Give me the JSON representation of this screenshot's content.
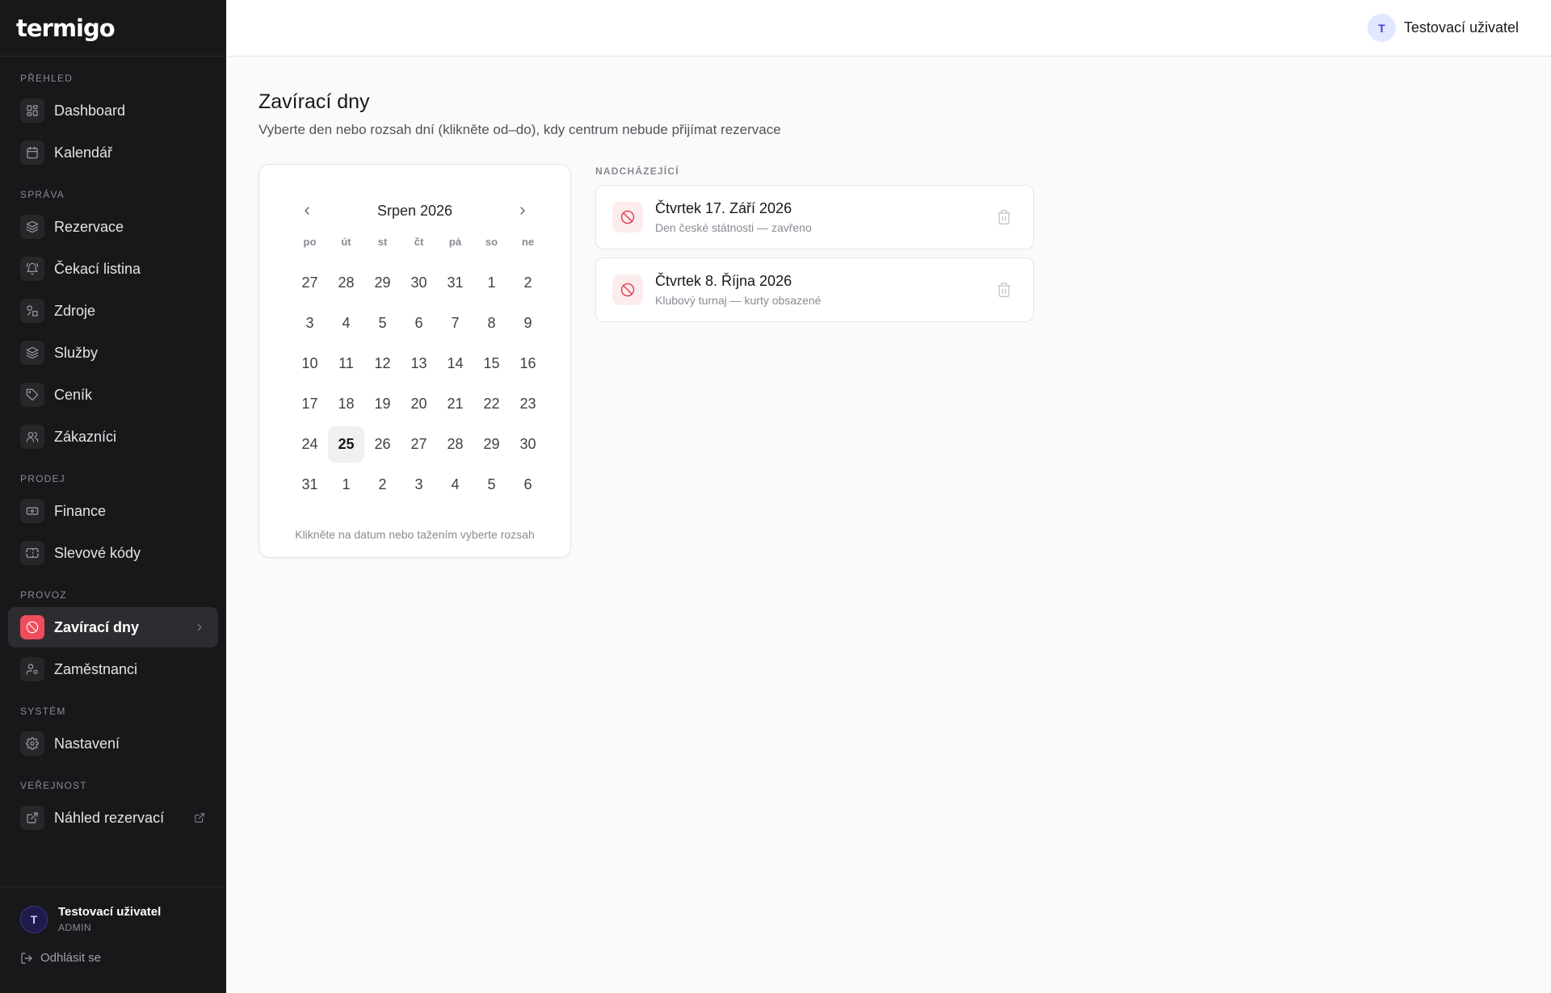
{
  "app": {
    "brand": "termigo"
  },
  "sidebar": {
    "sections": [
      {
        "label": "PŘEHLED",
        "items": [
          {
            "label": "Dashboard",
            "icon": "dashboard-icon"
          },
          {
            "label": "Kalendář",
            "icon": "calendar-icon"
          }
        ]
      },
      {
        "label": "SPRÁVA",
        "items": [
          {
            "label": "Rezervace",
            "icon": "layers-icon"
          },
          {
            "label": "Čekací listina",
            "icon": "bell-icon"
          },
          {
            "label": "Zdroje",
            "icon": "resources-icon"
          },
          {
            "label": "Služby",
            "icon": "layers-icon"
          },
          {
            "label": "Ceník",
            "icon": "tag-icon"
          },
          {
            "label": "Zákazníci",
            "icon": "users-icon"
          }
        ]
      },
      {
        "label": "PRODEJ",
        "items": [
          {
            "label": "Finance",
            "icon": "banknote-icon"
          },
          {
            "label": "Slevové kódy",
            "icon": "ticket-icon"
          }
        ]
      },
      {
        "label": "PROVOZ",
        "items": [
          {
            "label": "Zavírací dny",
            "icon": "ban-icon",
            "active": true
          },
          {
            "label": "Zaměstnanci",
            "icon": "user-cog-icon"
          }
        ]
      },
      {
        "label": "SYSTÉM",
        "items": [
          {
            "label": "Nastavení",
            "icon": "gear-icon"
          }
        ]
      },
      {
        "label": "VEŘEJNOST",
        "items": [
          {
            "label": "Náhled rezervací",
            "icon": "external-link-icon",
            "external": true
          }
        ]
      }
    ],
    "user": {
      "initial": "T",
      "name": "Testovací uživatel",
      "role": "ADMIN"
    },
    "logout_label": "Odhlásit se"
  },
  "topbar": {
    "user_initial": "T",
    "user_name": "Testovací uživatel"
  },
  "page": {
    "title": "Zavírací dny",
    "subtitle": "Vyberte den nebo rozsah dní (klikněte od–do), kdy centrum nebude přijímat rezervace"
  },
  "calendar": {
    "month_label": "Srpen 2026",
    "weekdays": [
      "po",
      "út",
      "st",
      "čt",
      "pá",
      "so",
      "ne"
    ],
    "weeks": [
      [
        "27",
        "28",
        "29",
        "30",
        "31",
        "1",
        "2"
      ],
      [
        "3",
        "4",
        "5",
        "6",
        "7",
        "8",
        "9"
      ],
      [
        "10",
        "11",
        "12",
        "13",
        "14",
        "15",
        "16"
      ],
      [
        "17",
        "18",
        "19",
        "20",
        "21",
        "22",
        "23"
      ],
      [
        "24",
        "25",
        "26",
        "27",
        "28",
        "29",
        "30"
      ],
      [
        "31",
        "1",
        "2",
        "3",
        "4",
        "5",
        "6"
      ]
    ],
    "today": "25",
    "hint": "Klikněte na datum nebo tažením vyberte rozsah"
  },
  "upcoming": {
    "label": "NADCHÁZEJÍCÍ",
    "items": [
      {
        "title": "Čtvrtek 17. Září 2026",
        "description": "Den české státnosti — zavřeno"
      },
      {
        "title": "Čtvrtek 8. Října 2026",
        "description": "Klubový turnaj — kurty obsazené"
      }
    ]
  },
  "colors": {
    "sidebar_bg": "#18181b",
    "accent": "#ef4d5b",
    "page_bg": "#fafafa"
  }
}
